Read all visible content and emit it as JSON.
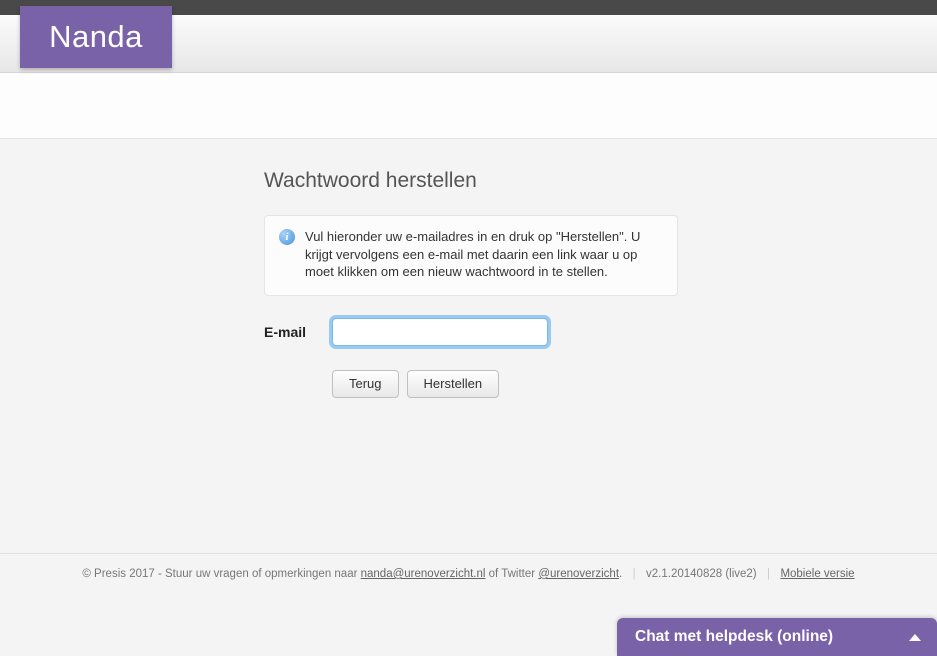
{
  "logo": "Nanda",
  "page": {
    "title": "Wachtwoord herstellen",
    "info_text": "Vul hieronder uw e-mailadres in en druk op \"Herstellen\". U krijgt vervolgens een e-mail met daarin een link waar u op moet klikken om een nieuw wachtwoord in te stellen."
  },
  "form": {
    "email_label": "E-mail",
    "email_value": "",
    "back_label": "Terug",
    "submit_label": "Herstellen"
  },
  "footer": {
    "copyright_prefix": "© Presis 2017 - Stuur uw vragen of opmerkingen naar ",
    "email_link": "nanda@urenoverzicht.nl",
    "twitter_prefix": " of Twitter ",
    "twitter_handle": "@urenoverzicht",
    "version": "v2.1.20140828 (live2)",
    "mobile_link": "Mobiele versie",
    "period": "."
  },
  "chat": {
    "label": "Chat met helpdesk (online)"
  }
}
